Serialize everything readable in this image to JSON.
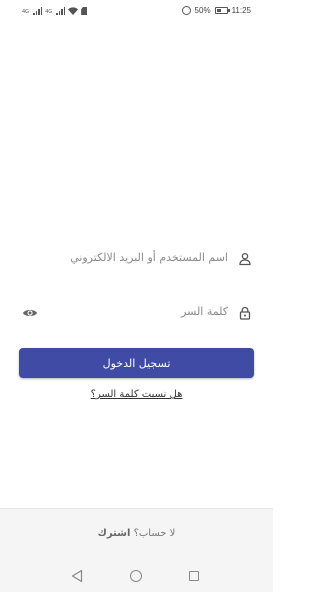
{
  "status_bar": {
    "network_labels": [
      "4G",
      "4G"
    ],
    "battery_percent": "50%",
    "time": "11:25",
    "icons": [
      "signal-icon",
      "signal-icon",
      "wifi-icon",
      "sdcard-icon",
      "alarm-icon",
      "battery-icon"
    ],
    "battery_level": 0.5
  },
  "login_form": {
    "username_placeholder": "اسم المستخدم أو البريد الالكتروني",
    "username_icon": "person-icon",
    "password_placeholder": "كلمة السر",
    "password_icon": "lock-icon",
    "password_toggle_icon": "eye-icon",
    "login_button_label": "تسجيل الدخول",
    "forgot_password_link": "هل نسيت كلمة السر؟"
  },
  "signup": {
    "prompt": "لا حساب؟",
    "link": "اشترك"
  },
  "nav_bar": {
    "icons": [
      "back-icon",
      "home-icon",
      "recent-apps-icon"
    ]
  },
  "colors": {
    "primary_button": "#3f4ba5",
    "background": "#ffffff",
    "bottom_panel": "#f5f5f5"
  }
}
